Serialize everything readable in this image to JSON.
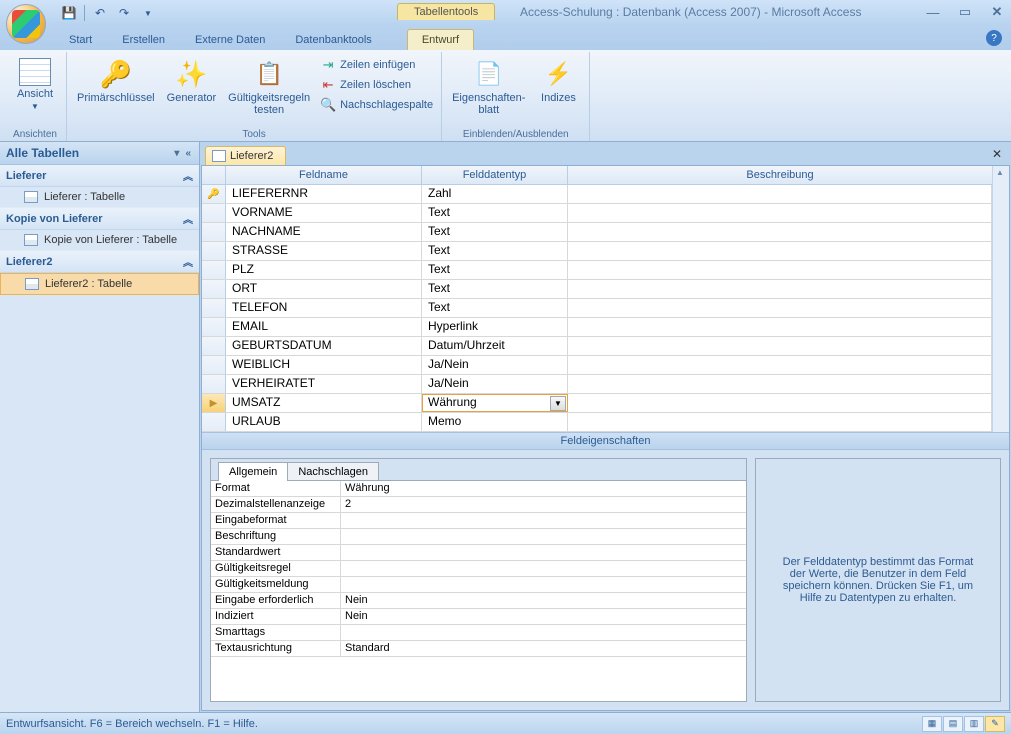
{
  "window": {
    "context_tool_label": "Tabellentools",
    "title": "Access-Schulung : Datenbank (Access 2007)  -  Microsoft Access"
  },
  "qat": {
    "save": "💾",
    "undo": "↶",
    "redo": "↷"
  },
  "ribbon_tabs": {
    "start": "Start",
    "erstellen": "Erstellen",
    "externe": "Externe Daten",
    "dbtools": "Datenbanktools",
    "entwurf": "Entwurf"
  },
  "ribbon": {
    "ansichten": {
      "ansicht": "Ansicht",
      "group": "Ansichten"
    },
    "tools": {
      "pk": "Primärschlüssel",
      "generator": "Generator",
      "gueltig": "Gültigkeitsregeln\ntesten",
      "zeilen_einf": "Zeilen einfügen",
      "zeilen_del": "Zeilen löschen",
      "nachschlag": "Nachschlagespalte",
      "group": "Tools"
    },
    "einaus": {
      "eigblatt": "Eigenschaften-\nblatt",
      "indizes": "Indizes",
      "group": "Einblenden/Ausblenden"
    }
  },
  "nav": {
    "title": "Alle Tabellen",
    "groups": [
      {
        "name": "Lieferer",
        "items": [
          "Lieferer : Tabelle"
        ]
      },
      {
        "name": "Kopie von Lieferer",
        "items": [
          "Kopie von Lieferer : Tabelle"
        ]
      },
      {
        "name": "Lieferer2",
        "items": [
          "Lieferer2 : Tabelle"
        ],
        "selected": true
      }
    ]
  },
  "doc": {
    "tab": "Lieferer2"
  },
  "design": {
    "headers": {
      "name": "Feldname",
      "type": "Felddatentyp",
      "desc": "Beschreibung"
    },
    "rows": [
      {
        "key": true,
        "name": "LIEFERERNR",
        "type": "Zahl"
      },
      {
        "name": "VORNAME",
        "type": "Text"
      },
      {
        "name": "NACHNAME",
        "type": "Text"
      },
      {
        "name": "STRASSE",
        "type": "Text"
      },
      {
        "name": "PLZ",
        "type": "Text"
      },
      {
        "name": "ORT",
        "type": "Text"
      },
      {
        "name": "TELEFON",
        "type": "Text"
      },
      {
        "name": "EMAIL",
        "type": "Hyperlink"
      },
      {
        "name": "GEBURTSDATUM",
        "type": "Datum/Uhrzeit"
      },
      {
        "name": "WEIBLICH",
        "type": "Ja/Nein"
      },
      {
        "name": "VERHEIRATET",
        "type": "Ja/Nein"
      },
      {
        "name": "UMSATZ",
        "type": "Währung",
        "selected": true
      },
      {
        "name": "URLAUB",
        "type": "Memo"
      }
    ]
  },
  "field_props": {
    "title": "Feldeigenschaften",
    "tabs": {
      "allgemein": "Allgemein",
      "nachschlagen": "Nachschlagen"
    },
    "rows": [
      {
        "label": "Format",
        "value": "Währung"
      },
      {
        "label": "Dezimalstellenanzeige",
        "value": "2"
      },
      {
        "label": "Eingabeformat",
        "value": ""
      },
      {
        "label": "Beschriftung",
        "value": ""
      },
      {
        "label": "Standardwert",
        "value": ""
      },
      {
        "label": "Gültigkeitsregel",
        "value": ""
      },
      {
        "label": "Gültigkeitsmeldung",
        "value": ""
      },
      {
        "label": "Eingabe erforderlich",
        "value": "Nein"
      },
      {
        "label": "Indiziert",
        "value": "Nein"
      },
      {
        "label": "Smarttags",
        "value": ""
      },
      {
        "label": "Textausrichtung",
        "value": "Standard"
      }
    ],
    "hint": "Der Felddatentyp bestimmt das Format der Werte, die Benutzer in dem Feld speichern können. Drücken Sie F1, um Hilfe zu Datentypen zu erhalten."
  },
  "status": {
    "text": "Entwurfsansicht. F6 = Bereich wechseln. F1 = Hilfe."
  }
}
